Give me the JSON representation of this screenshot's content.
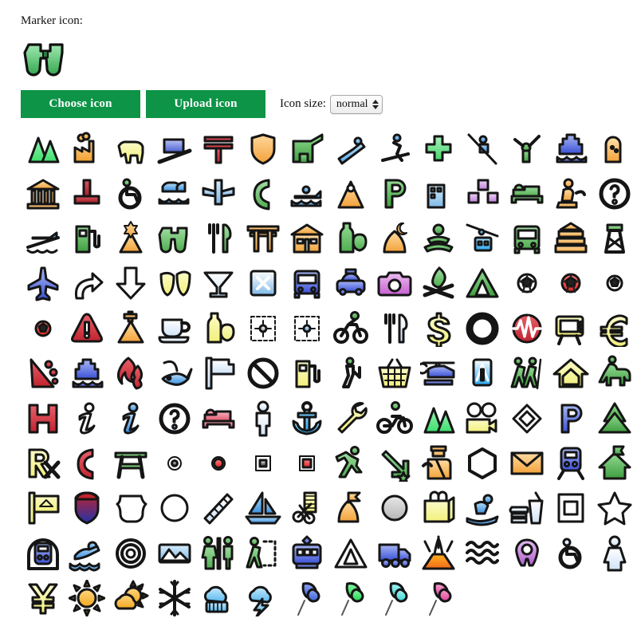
{
  "header": {
    "marker_label": "Marker icon:",
    "current_icon": "binoculars-icon"
  },
  "toolbar": {
    "choose_label": "Choose icon",
    "upload_label": "Upload icon",
    "size_label": "Icon size:",
    "size_value": "normal",
    "size_options": [
      "normal"
    ],
    "button_color": "#0d9447",
    "button_text_color": "#ffffff"
  },
  "grid": {
    "columns": 14,
    "cell_size": 56,
    "icons": [
      {
        "n": "mountains-icon",
        "c": "#3ce06a",
        "c2": "#9bf0b6",
        "s": "mountains"
      },
      {
        "n": "factory-icon",
        "c": "#f0a030",
        "c2": "#ffd08a",
        "s": "factory"
      },
      {
        "n": "cow-icon",
        "c": "#f2f07a",
        "c2": "#fbfbc8",
        "s": "cow"
      },
      {
        "n": "funicular-icon",
        "c": "#4a5fd0",
        "c2": "#b9c4f5",
        "s": "funicular"
      },
      {
        "n": "post-office-icon",
        "c": "#c0232e",
        "c2": "#e8616a",
        "s": "postoffice"
      },
      {
        "n": "police-badge-icon",
        "c": "#f2a23a",
        "c2": "#ffd79b",
        "s": "badge"
      },
      {
        "n": "animal-shelter-icon",
        "c": "#3f9e3f",
        "c2": "#8fd98f",
        "s": "shelterdog"
      },
      {
        "n": "slide-icon",
        "c": "#56a8e8",
        "c2": "#b9ddf7",
        "s": "slide"
      },
      {
        "n": "skier-icon",
        "c": "#3a90e0",
        "c2": "#a9d4f5",
        "s": "skier"
      },
      {
        "n": "pharmacy-cross-icon",
        "c": "#46d46a",
        "c2": "#a6f0ba",
        "s": "cross"
      },
      {
        "n": "chairlift-icon",
        "c": "#3a90e0",
        "c2": "#aad4f5",
        "s": "chairlift"
      },
      {
        "n": "fountain-statue-icon",
        "c": "#3f9e3f",
        "c2": "#93d993",
        "s": "statue"
      },
      {
        "n": "ferry-icon",
        "c": "#3b51d6",
        "c2": "#a8b6f3",
        "s": "ship"
      },
      {
        "n": "gravestone-icon",
        "c": "#f2a23a",
        "c2": "#ffe0ad",
        "s": "grave"
      },
      {
        "n": "museum-icon",
        "c": "#f2a23a",
        "c2": "#ffdca3",
        "s": "museum"
      },
      {
        "n": "cross-monument-icon",
        "c": "#9c1c25",
        "c2": "#d9535d",
        "s": "tmark"
      },
      {
        "n": "wheelchair-icon",
        "c": "#4fae4f",
        "c2": "#9fdb9f",
        "s": "wheelchair"
      },
      {
        "n": "ferry-cars-icon",
        "c": "#3a90e0",
        "c2": "#b7dcf6",
        "s": "carferry"
      },
      {
        "n": "lighthouse-icon",
        "c": "#7fb8e8",
        "c2": "#d6ecfa",
        "s": "tower2"
      },
      {
        "n": "telephone-icon",
        "c": "#4fae4f",
        "c2": "#a4dca4",
        "s": "phone"
      },
      {
        "n": "boat-tour-icon",
        "c": "#3a90e0",
        "c2": "#b7dcf6",
        "s": "boattour"
      },
      {
        "n": "sauna-icon",
        "c": "#f2a23a",
        "c2": "#ffdca3",
        "s": "sauna"
      },
      {
        "n": "parking-icon",
        "c": "#3f9e3f",
        "c2": "#93d993",
        "s": "letterP"
      },
      {
        "n": "office-building-icon",
        "c": "#7fb8e8",
        "c2": "#d6ecfa",
        "s": "office"
      },
      {
        "n": "squares-icon",
        "c": "#c07fd8",
        "c2": "#ecd2f5",
        "s": "squares"
      },
      {
        "n": "hotel-bed-icon",
        "c": "#4fae4f",
        "c2": "#9fdb9f",
        "s": "bed"
      },
      {
        "n": "praying-person-icon",
        "c": "#f2a23a",
        "c2": "#ffdca3",
        "s": "pray"
      },
      {
        "n": "question-circle-icon",
        "c": "#4fae4f",
        "c2": "#ffffff",
        "s": "qcircle"
      },
      {
        "n": "slipway-icon",
        "c": "#3a90e0",
        "c2": "#b7dcf6",
        "s": "slipway"
      },
      {
        "n": "fuel-pump-icon",
        "c": "#3f9e3f",
        "c2": "#93d993",
        "s": "fuel"
      },
      {
        "n": "synagogue-icon",
        "c": "#f2a23a",
        "c2": "#ffdca3",
        "s": "synagogue"
      },
      {
        "n": "binoculars-icon",
        "c": "#4fae4f",
        "c2": "#9fdb9f",
        "s": "binoculars"
      },
      {
        "n": "restaurant-icon",
        "c": "#4fae4f",
        "c2": "#a4dca4",
        "s": "forkknife"
      },
      {
        "n": "torii-icon",
        "c": "#f2a23a",
        "c2": "#ffdca3",
        "s": "torii"
      },
      {
        "n": "school-icon",
        "c": "#f2a23a",
        "c2": "#ffdca3",
        "s": "school"
      },
      {
        "n": "drinks-icon",
        "c": "#4fae4f",
        "c2": "#93d993",
        "s": "bottleapple"
      },
      {
        "n": "mosque-icon",
        "c": "#f2a23a",
        "c2": "#ffdca3",
        "s": "mosque"
      },
      {
        "n": "viewpoint-icon",
        "c": "#3f9e3f",
        "c2": "#93d993",
        "s": "rings"
      },
      {
        "n": "cable-car-icon",
        "c": "#2aa8ef",
        "c2": "#a6dcf8",
        "s": "cablecar"
      },
      {
        "n": "bus-icon",
        "c": "#4fae4f",
        "c2": "#a4dca4",
        "s": "bus"
      },
      {
        "n": "temple-icon",
        "c": "#f2a23a",
        "c2": "#ffe0ad",
        "s": "temple"
      },
      {
        "n": "watchtower-icon",
        "c": "#4fae4f",
        "c2": "#a4dca4",
        "s": "tower"
      },
      {
        "n": "airport-icon",
        "c": "#3b51d6",
        "c2": "#a8b6f3",
        "s": "plane"
      },
      {
        "n": "turn-right-icon",
        "c": "#ffffff",
        "c2": "#ffffff",
        "s": "arrowcurve"
      },
      {
        "n": "arrow-down-icon",
        "c": "#ffffff",
        "c2": "#ffffff",
        "s": "arrowdown"
      },
      {
        "n": "theatre-masks-icon",
        "c": "#f2f07a",
        "c2": "#fbfbc8",
        "s": "masks"
      },
      {
        "n": "cocktail-icon",
        "c": "#cfe3f7",
        "c2": "#ffffff",
        "s": "cocktail"
      },
      {
        "n": "close-box-icon",
        "c": "#7fb8e8",
        "c2": "#ffffff",
        "s": "xbox"
      },
      {
        "n": "bus-station-icon",
        "c": "#3b51d6",
        "c2": "#a8b6f3",
        "s": "bus"
      },
      {
        "n": "taxi-icon",
        "c": "#3b51d6",
        "c2": "#a8b6f3",
        "s": "taxi"
      },
      {
        "n": "camera-icon",
        "c": "#c75fd0",
        "c2": "#eabdf0",
        "s": "camera"
      },
      {
        "n": "campfire-icon",
        "c": "#4fae4f",
        "c2": "#9fdb9f",
        "s": "campfire"
      },
      {
        "n": "camping-icon",
        "c": "#3f9e3f",
        "c2": "#93d993",
        "s": "tent"
      },
      {
        "n": "soccer-ball-white-icon",
        "c": "#ffffff",
        "c2": "#ffffff",
        "s": "ballw"
      },
      {
        "n": "soccer-ball-red-icon",
        "c": "#e02020",
        "c2": "#ff8080",
        "s": "ballr"
      },
      {
        "n": "soccer-ball-small-white-icon",
        "c": "#ffffff",
        "c2": "#ffffff",
        "s": "ballws"
      },
      {
        "n": "soccer-ball-small-red-icon",
        "c": "#e02020",
        "c2": "#ff8080",
        "s": "ballrs"
      },
      {
        "n": "warning-icon",
        "c": "#c0232e",
        "c2": "#e8616a",
        "s": "warning"
      },
      {
        "n": "church-icon",
        "c": "#f2a23a",
        "c2": "#ffdca3",
        "s": "church"
      },
      {
        "n": "cafe-icon",
        "c": "#cfe3f7",
        "c2": "#ffffff",
        "s": "cup"
      },
      {
        "n": "groceries-icon",
        "c": "#f2f07a",
        "c2": "#fbfbc8",
        "s": "bottleapple"
      },
      {
        "n": "crosshair-grey-icon",
        "c": "#9a9a9a",
        "c2": "#ffffff",
        "s": "cross4"
      },
      {
        "n": "crosshair-blue-icon",
        "c": "#3a90e0",
        "c2": "#ffffff",
        "s": "cross4"
      },
      {
        "n": "cycling-icon",
        "c": "#3f9e3f",
        "c2": "#93d993",
        "s": "cyclist"
      },
      {
        "n": "cutlery-icon",
        "c": "#cfe3f7",
        "c2": "#ffffff",
        "s": "forkknife"
      },
      {
        "n": "dollar-icon",
        "c": "#f2f07a",
        "c2": "#fbfbc8",
        "s": "dollar"
      },
      {
        "n": "ring-icon",
        "c": "#ffffff",
        "c2": "#ffffff",
        "s": "ring"
      },
      {
        "n": "defibrillator-icon",
        "c": "#c0232e",
        "c2": "#e8616a",
        "s": "pulse"
      },
      {
        "n": "television-icon",
        "c": "#f2f07a",
        "c2": "#fbfbc8",
        "s": "tv"
      },
      {
        "n": "euro-icon",
        "c": "#f2f07a",
        "c2": "#fbfbc8",
        "s": "euro"
      },
      {
        "n": "rockfall-icon",
        "c": "#c0232e",
        "c2": "#e8616a",
        "s": "rockfall"
      },
      {
        "n": "cruise-ship-icon",
        "c": "#3b51d6",
        "c2": "#a8b6f3",
        "s": "ship"
      },
      {
        "n": "fire-icon",
        "c": "#c0232e",
        "c2": "#e8616a",
        "s": "fire"
      },
      {
        "n": "fishing-icon",
        "c": "#3a90e0",
        "c2": "#b7dcf6",
        "s": "fish"
      },
      {
        "n": "flag-icon",
        "c": "#cfe3f7",
        "c2": "#ffffff",
        "s": "flag"
      },
      {
        "n": "no-entry-icon",
        "c": "#ffffff",
        "c2": "#ffffff",
        "s": "noentry"
      },
      {
        "n": "fuel-yellow-icon",
        "c": "#f2f07a",
        "c2": "#fbfbc8",
        "s": "fuel"
      },
      {
        "n": "golf-icon",
        "c": "#4fae4f",
        "c2": "#9fdb9f",
        "s": "golf"
      },
      {
        "n": "shopping-basket-icon",
        "c": "#f2f07a",
        "c2": "#fbfbc8",
        "s": "basket"
      },
      {
        "n": "helicopter-icon",
        "c": "#3b51d6",
        "c2": "#a8b6f3",
        "s": "helicopter"
      },
      {
        "n": "motorway-sign-icon",
        "c": "#2aa8ef",
        "c2": "#ffffff",
        "s": "motorway"
      },
      {
        "n": "hikers-icon",
        "c": "#3f9e3f",
        "c2": "#93d993",
        "s": "hikers"
      },
      {
        "n": "house-outline-icon",
        "c": "#f2f07a",
        "c2": "#fbfbc8",
        "s": "houseout"
      },
      {
        "n": "horse-riding-icon",
        "c": "#3f9e3f",
        "c2": "#93d993",
        "s": "horse"
      },
      {
        "n": "hospital-h-icon",
        "c": "#c0232e",
        "c2": "#e8616a",
        "s": "letterH"
      },
      {
        "n": "info-white-icon",
        "c": "#ffffff",
        "c2": "#ffffff",
        "s": "infoi"
      },
      {
        "n": "info-blue-icon",
        "c": "#3a90e0",
        "c2": "#b7dcf6",
        "s": "infoi"
      },
      {
        "n": "help-circle-icon",
        "c": "#3a90e0",
        "c2": "#ffffff",
        "s": "qcircle"
      },
      {
        "n": "bed-pink-icon",
        "c": "#e0556a",
        "c2": "#f8b3bf",
        "s": "bed"
      },
      {
        "n": "person-icon",
        "c": "#cfe3f7",
        "c2": "#ffffff",
        "s": "person"
      },
      {
        "n": "anchor-icon",
        "c": "#2aa8ef",
        "c2": "#a6dcf8",
        "s": "anchor"
      },
      {
        "n": "wrench-icon",
        "c": "#f2f07a",
        "c2": "#fbfbc8",
        "s": "wrench"
      },
      {
        "n": "motorcycle-icon",
        "c": "#4fae4f",
        "c2": "#9fdb9f",
        "s": "motorcycle"
      },
      {
        "n": "mountains-green-icon",
        "c": "#3ce06a",
        "c2": "#9bf0b6",
        "s": "mountains"
      },
      {
        "n": "movie-projector-icon",
        "c": "#f2f07a",
        "c2": "#fbfbc8",
        "s": "projector"
      },
      {
        "n": "diamond-icon",
        "c": "#ffffff",
        "c2": "#ffffff",
        "s": "diamond"
      },
      {
        "n": "parking-blue-icon",
        "c": "#3b51d6",
        "c2": "#a8b6f3",
        "s": "letterP"
      },
      {
        "n": "pine-tree-icon",
        "c": "#3f9e3f",
        "c2": "#93d993",
        "s": "pine"
      },
      {
        "n": "pharmacy-rx-icon",
        "c": "#f2f07a",
        "c2": "#fbfbc8",
        "s": "rx"
      },
      {
        "n": "phone-red-icon",
        "c": "#c0232e",
        "c2": "#e8616a",
        "s": "phone"
      },
      {
        "n": "picnic-table-green-icon",
        "c": "#4fae4f",
        "c2": "#9fdb9f",
        "s": "picnic"
      },
      {
        "n": "dot-small-black-icon",
        "c": "#222222",
        "c2": "#ffffff",
        "s": "dotb"
      },
      {
        "n": "dot-red-icon",
        "c": "#e02020",
        "c2": "#ff8080",
        "s": "dotr"
      },
      {
        "n": "square-small-black-icon",
        "c": "#222222",
        "c2": "#ffffff",
        "s": "sqb"
      },
      {
        "n": "square-red-icon",
        "c": "#e02020",
        "c2": "#ff8080",
        "s": "sqr"
      },
      {
        "n": "runner-icon",
        "c": "#4fae4f",
        "c2": "#9fdb9f",
        "s": "runner"
      },
      {
        "n": "arrow-star-icon",
        "c": "#4fae4f",
        "c2": "#9fdb9f",
        "s": "arrowstar"
      },
      {
        "n": "officer-icon",
        "c": "#f2a23a",
        "c2": "#ffdca3",
        "s": "officer"
      },
      {
        "n": "hexagon-icon",
        "c": "#ffffff",
        "c2": "#ffffff",
        "s": "hexagon"
      },
      {
        "n": "envelope-icon",
        "c": "#f2a23a",
        "c2": "#ffdca3",
        "s": "envelope"
      },
      {
        "n": "train-icon",
        "c": "#3b51d6",
        "c2": "#a8b6f3",
        "s": "train"
      },
      {
        "n": "house-flag-icon",
        "c": "#3f9e3f",
        "c2": "#93d993",
        "s": "housef"
      },
      {
        "n": "signpost-icon",
        "c": "#f2f07a",
        "c2": "#fbfbc8",
        "s": "signpost"
      },
      {
        "n": "interstate-shield-icon",
        "c": "#2232a8",
        "c2": "#c0232e",
        "s": "interstate"
      },
      {
        "n": "highway-shield-icon",
        "c": "#ffffff",
        "c2": "#ffffff",
        "s": "shield"
      },
      {
        "n": "circle-white-icon",
        "c": "#ffffff",
        "c2": "#ffffff",
        "s": "circle"
      },
      {
        "n": "ruler-icon",
        "c": "#cfe3f7",
        "c2": "#ffffff",
        "s": "ruler"
      },
      {
        "n": "sailboat-icon",
        "c": "#3a90e0",
        "c2": "#b7dcf6",
        "s": "sailboat"
      },
      {
        "n": "hairdresser-icon",
        "c": "#f2f07a",
        "c2": "#fbfbc8",
        "s": "scissors"
      },
      {
        "n": "flag-marker-icon",
        "c": "#f2a23a",
        "c2": "#ffdca3",
        "s": "flagmarker"
      },
      {
        "n": "grey-ball-icon",
        "c": "#b5b5b5",
        "c2": "#e8e8e8",
        "s": "sphere"
      },
      {
        "n": "shopping-bag-icon",
        "c": "#f2f07a",
        "c2": "#fbfbc8",
        "s": "bag"
      },
      {
        "n": "snowboarder-icon",
        "c": "#3a90e0",
        "c2": "#b7dcf6",
        "s": "snowboard"
      },
      {
        "n": "fast-food-icon",
        "c": "#cfe3f7",
        "c2": "#ffffff",
        "s": "fastfood"
      },
      {
        "n": "picture-frame-icon",
        "c": "#ffffff",
        "c2": "#ffffff",
        "s": "frame"
      },
      {
        "n": "star-icon",
        "c": "#ffffff",
        "c2": "#ffffff",
        "s": "star"
      },
      {
        "n": "subway-icon",
        "c": "#3b51d6",
        "c2": "#a8b6f3",
        "s": "subway"
      },
      {
        "n": "swimming-icon",
        "c": "#3a90e0",
        "c2": "#b7dcf6",
        "s": "swimmer"
      },
      {
        "n": "target-icon",
        "c": "#ffffff",
        "c2": "#ffffff",
        "s": "target"
      },
      {
        "n": "scenery-icon",
        "c": "#7fb8e8",
        "c2": "#d6ecfa",
        "s": "scenery"
      },
      {
        "n": "toilets-icon",
        "c": "#4fae4f",
        "c2": "#9fdb9f",
        "s": "toilets"
      },
      {
        "n": "trail-icon",
        "c": "#4fae4f",
        "c2": "#9fdb9f",
        "s": "trail"
      },
      {
        "n": "tram-icon",
        "c": "#3b51d6",
        "c2": "#a8b6f3",
        "s": "tram"
      },
      {
        "n": "triangle-warning-icon",
        "c": "#ffffff",
        "c2": "#ffffff",
        "s": "tri"
      },
      {
        "n": "truck-icon",
        "c": "#3b51d6",
        "c2": "#a8b6f3",
        "s": "truck"
      },
      {
        "n": "volcano-icon",
        "c": "#f06a1a",
        "c2": "#ffb020",
        "s": "volcano"
      },
      {
        "n": "waves-icon",
        "c": "#3a90e0",
        "c2": "#b7dcf6",
        "s": "waves"
      },
      {
        "n": "baby-icon",
        "c": "#b05fd0",
        "c2": "#e4bdf0",
        "s": "baby"
      },
      {
        "n": "wheelchair-blue-icon",
        "c": "#cfe3f7",
        "c2": "#ffffff",
        "s": "wheelchair"
      },
      {
        "n": "woman-icon",
        "c": "#cfe3f7",
        "c2": "#ffffff",
        "s": "woman"
      },
      {
        "n": "yen-icon",
        "c": "#f2f07a",
        "c2": "#fbfbc8",
        "s": "yen"
      },
      {
        "n": "sunny-icon",
        "c": "#f2a820",
        "c2": "#ffd680",
        "s": "sun"
      },
      {
        "n": "partly-cloudy-icon",
        "c": "#f2a820",
        "c2": "#ffd680",
        "s": "suncloud"
      },
      {
        "n": "snowflake-icon",
        "c": "#56b8ef",
        "c2": "#c8e8fa",
        "s": "snowflake"
      },
      {
        "n": "rain-icon",
        "c": "#56b8ef",
        "c2": "#c8e8fa",
        "s": "rain"
      },
      {
        "n": "thunderstorm-icon",
        "c": "#56b8ef",
        "c2": "#c8e8fa",
        "s": "storm"
      },
      {
        "n": "pin-blue-icon",
        "c": "#3b5fd6",
        "c2": "#8fa6f3",
        "s": "pin"
      },
      {
        "n": "pin-green-icon",
        "c": "#19d84a",
        "c2": "#8ef3a8",
        "s": "pin"
      },
      {
        "n": "pin-cyan-icon",
        "c": "#3fd6d6",
        "c2": "#a6f3f3",
        "s": "pin"
      },
      {
        "n": "pin-pink-icon",
        "c": "#e0409a",
        "c2": "#f3a0cc",
        "s": "pin"
      }
    ]
  }
}
